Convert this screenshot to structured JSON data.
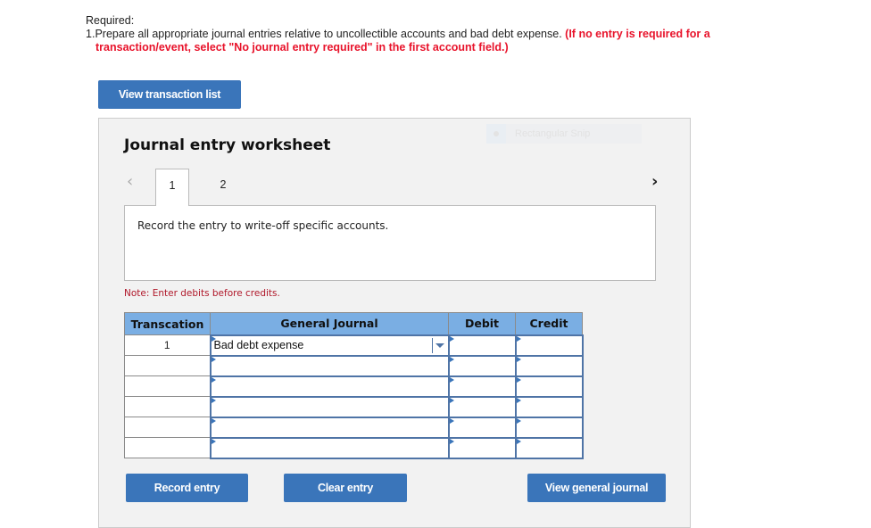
{
  "instructions": {
    "heading": "Required:",
    "item_number": "1.",
    "text": "Prepare all appropriate journal entries relative to uncollectible accounts and bad debt expense.",
    "note_red_part1": "(If no entry is required for a",
    "note_red_part2": "transaction/event, select \"No journal entry required\" in the first account field.)"
  },
  "buttons": {
    "view_transaction_list": "View transaction list",
    "record_entry": "Record entry",
    "clear_entry": "Clear entry",
    "view_general_journal": "View general journal"
  },
  "overlay": {
    "snip_label": "Rectangular Snip"
  },
  "worksheet": {
    "title": "Journal entry worksheet",
    "prev_icon": "‹",
    "next_icon": "›",
    "tabs": [
      {
        "label": "1",
        "active": true
      },
      {
        "label": "2",
        "active": false
      }
    ],
    "description": "Record the entry to write-off specific accounts.",
    "note": "Note: Enter debits before credits."
  },
  "table": {
    "headers": [
      "Transcation",
      "General Journal",
      "Debit",
      "Credit"
    ],
    "rows": [
      {
        "transaction": "1",
        "account": "Bad debt expense",
        "debit": "",
        "credit": ""
      },
      {
        "transaction": "",
        "account": "",
        "debit": "",
        "credit": ""
      },
      {
        "transaction": "",
        "account": "",
        "debit": "",
        "credit": ""
      },
      {
        "transaction": "",
        "account": "",
        "debit": "",
        "credit": ""
      },
      {
        "transaction": "",
        "account": "",
        "debit": "",
        "credit": ""
      },
      {
        "transaction": "",
        "account": "",
        "debit": "",
        "credit": ""
      }
    ]
  },
  "colors": {
    "button_blue": "#3a75ba",
    "header_blue": "#7aaee3",
    "instruction_red": "#e8132b",
    "note_red": "#b0182a"
  }
}
